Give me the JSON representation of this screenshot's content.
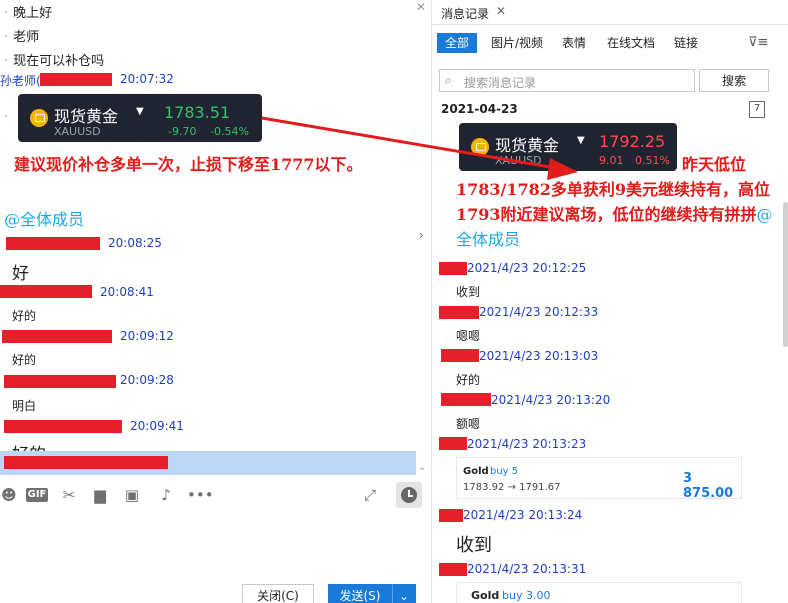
{
  "chat": {
    "messages": {
      "m1": "晚上好",
      "m2": "老师",
      "m3": "现在可以补仓吗",
      "sender1": "孙老师(",
      "time1": "20:07:32",
      "time2": "20:08:25",
      "reply1": "好",
      "time3": "20:08:41",
      "reply2": "好的",
      "time4": "20:09:12",
      "reply3": "好的",
      "time5": "20:09:28",
      "reply4": "明白",
      "time6": "20:09:41",
      "reply5": "好的",
      "mention": "@全体成员"
    },
    "quote": {
      "name": "现货黄金",
      "price": "1783.51",
      "symbol": "XAUUSD",
      "change": "-9.70",
      "change_pct": "-0.54%"
    },
    "annotation": "建议现价补仓多单一次，止损下移至1777以下。",
    "buttons": {
      "close": "关闭(C)",
      "send": "发送(S)"
    }
  },
  "history": {
    "title": "消息记录",
    "tabs": [
      "全部",
      "图片/视频",
      "表情",
      "在线文档",
      "链接"
    ],
    "search_placeholder": "搜索消息记录",
    "search_button": "搜索",
    "date": "2021-04-23",
    "calendar_day": "7",
    "quote": {
      "name": "现货黄金",
      "price": "1792.25",
      "symbol": "XAUUSD",
      "change": "9.01",
      "change_pct": "0.51%"
    },
    "annotation": "昨天低位1783/1782多单获利9美元继续持有，高位1793附近建议离场，低位的继续持有拼拼",
    "mention": "@全体成员",
    "entries": {
      "t1": "2021/4/23 20:12:25",
      "r1": "收到",
      "t2": "2021/4/23 20:12:33",
      "r2": "嗯嗯",
      "t3": "2021/4/23 20:13:03",
      "r3": "好的",
      "t4": "2021/4/23 20:13:20",
      "r4": "额嗯",
      "t5": "2021/4/23 20:13:23",
      "t6": "2021/4/23 20:13:24",
      "r6": "收到",
      "t7": "2021/4/23 20:13:31"
    },
    "trade1": {
      "label": "Gold",
      "side": "buy 5",
      "from_to": "1783.92 → 1791.67",
      "amount": "3 875.00"
    },
    "trade2": {
      "label": "Gold",
      "side": "buy 3.00"
    }
  },
  "colors": {
    "accent": "#1a7ad9",
    "annotation": "#e21b1b",
    "redaction": "#e5202a",
    "up": "#ff4b4b",
    "down": "#2ec26a"
  }
}
